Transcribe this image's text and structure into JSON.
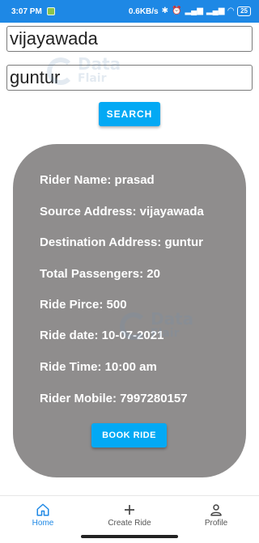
{
  "status_bar": {
    "time": "3:07 PM",
    "speed": "0.6KB/s",
    "battery": "25"
  },
  "search": {
    "from_value": "vijayawada",
    "to_value": "guntur",
    "button_label": "SEARCH"
  },
  "watermark": {
    "line1": "Data",
    "line2": "Flair"
  },
  "ride": {
    "rider_name": "Rider Name: prasad",
    "source": "Source Address: vijayawada",
    "destination": "Destination Address: guntur",
    "passengers": "Total Passengers: 20",
    "price": "Ride Pirce: 500",
    "date": "Ride date: 10-07-2021",
    "time": "Ride Time: 10:00 am",
    "mobile": "Rider Mobile: 7997280157",
    "book_label": "BOOK RIDE"
  },
  "nav": {
    "items": [
      {
        "label": "Home",
        "icon": "home-icon"
      },
      {
        "label": "Create Ride",
        "icon": "plus-icon"
      },
      {
        "label": "Profile",
        "icon": "person-icon"
      }
    ]
  },
  "colors": {
    "accent": "#03a9f4",
    "status_bar": "#1e88e5",
    "card": "#8f8d8d"
  }
}
